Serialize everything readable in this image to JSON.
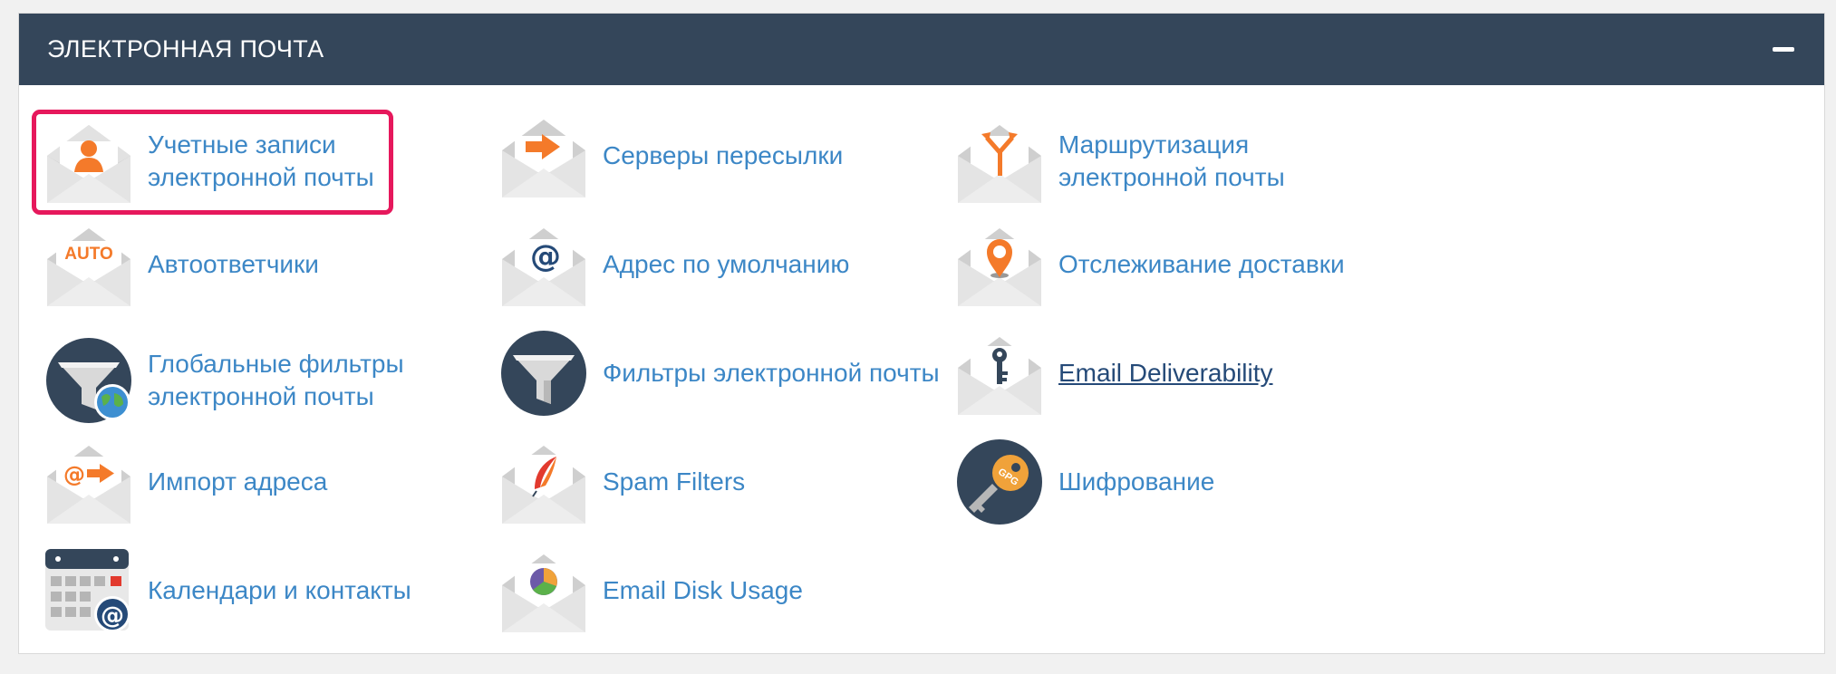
{
  "section": {
    "title": "ЭЛЕКТРОННАЯ ПОЧТА",
    "collapse_icon": "minus-icon"
  },
  "colors": {
    "header_bg": "#34465a",
    "link": "#3c87c6",
    "link_active": "#254a78",
    "highlight": "#e6185c",
    "accent_orange": "#f47a2a"
  },
  "items": [
    {
      "label": "Учетные записи электронной почты",
      "icon": "email-accounts-icon",
      "highlighted": true
    },
    {
      "label": "Серверы пересылки",
      "icon": "forwarders-icon"
    },
    {
      "label": "Маршрутизация электронной почты",
      "icon": "email-routing-icon"
    },
    {
      "label": "Автоответчики",
      "icon": "autoresponders-icon",
      "icon_text": "AUTO"
    },
    {
      "label": "Адрес по умолчанию",
      "icon": "default-address-icon"
    },
    {
      "label": "Отслеживание доставки",
      "icon": "track-delivery-icon"
    },
    {
      "label": "Глобальные фильтры электронной почты",
      "icon": "global-filters-icon"
    },
    {
      "label": "Фильтры электронной почты",
      "icon": "email-filters-icon"
    },
    {
      "label": "Email Deliverability",
      "icon": "email-deliverability-icon"
    },
    {
      "label": "Импорт адреса",
      "icon": "address-importer-icon"
    },
    {
      "label": "Spam Filters",
      "icon": "spam-filters-icon"
    },
    {
      "label": "Шифрование",
      "icon": "encryption-icon",
      "icon_text": "GPG"
    },
    {
      "label": "Календари и контакты",
      "icon": "calendars-contacts-icon"
    },
    {
      "label": "Email Disk Usage",
      "icon": "email-disk-usage-icon"
    }
  ]
}
